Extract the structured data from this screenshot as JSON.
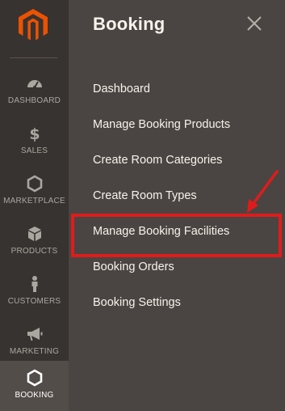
{
  "rail": {
    "items": [
      {
        "label": "DASHBOARD",
        "icon": "dashboard-icon"
      },
      {
        "label": "SALES",
        "icon": "dollar-icon"
      },
      {
        "label": "MARKETPLACE",
        "icon": "hexagon-icon"
      },
      {
        "label": "PRODUCTS",
        "icon": "box-icon"
      },
      {
        "label": "CUSTOMERS",
        "icon": "person-icon"
      },
      {
        "label": "MARKETING",
        "icon": "megaphone-icon"
      },
      {
        "label": "BOOKING",
        "icon": "hexagon-icon",
        "active": true
      }
    ]
  },
  "panel": {
    "title": "Booking",
    "menu": [
      {
        "label": "Dashboard"
      },
      {
        "label": "Manage Booking Products"
      },
      {
        "label": "Create Room Categories"
      },
      {
        "label": "Create Room Types"
      },
      {
        "label": "Manage Booking Facilities",
        "highlighted": true
      },
      {
        "label": "Booking Orders"
      },
      {
        "label": "Booking Settings"
      }
    ]
  },
  "colors": {
    "rail_bg": "#373330",
    "panel_bg": "#4a4542",
    "brand": "#eb5202",
    "highlight": "#e11b1b"
  }
}
